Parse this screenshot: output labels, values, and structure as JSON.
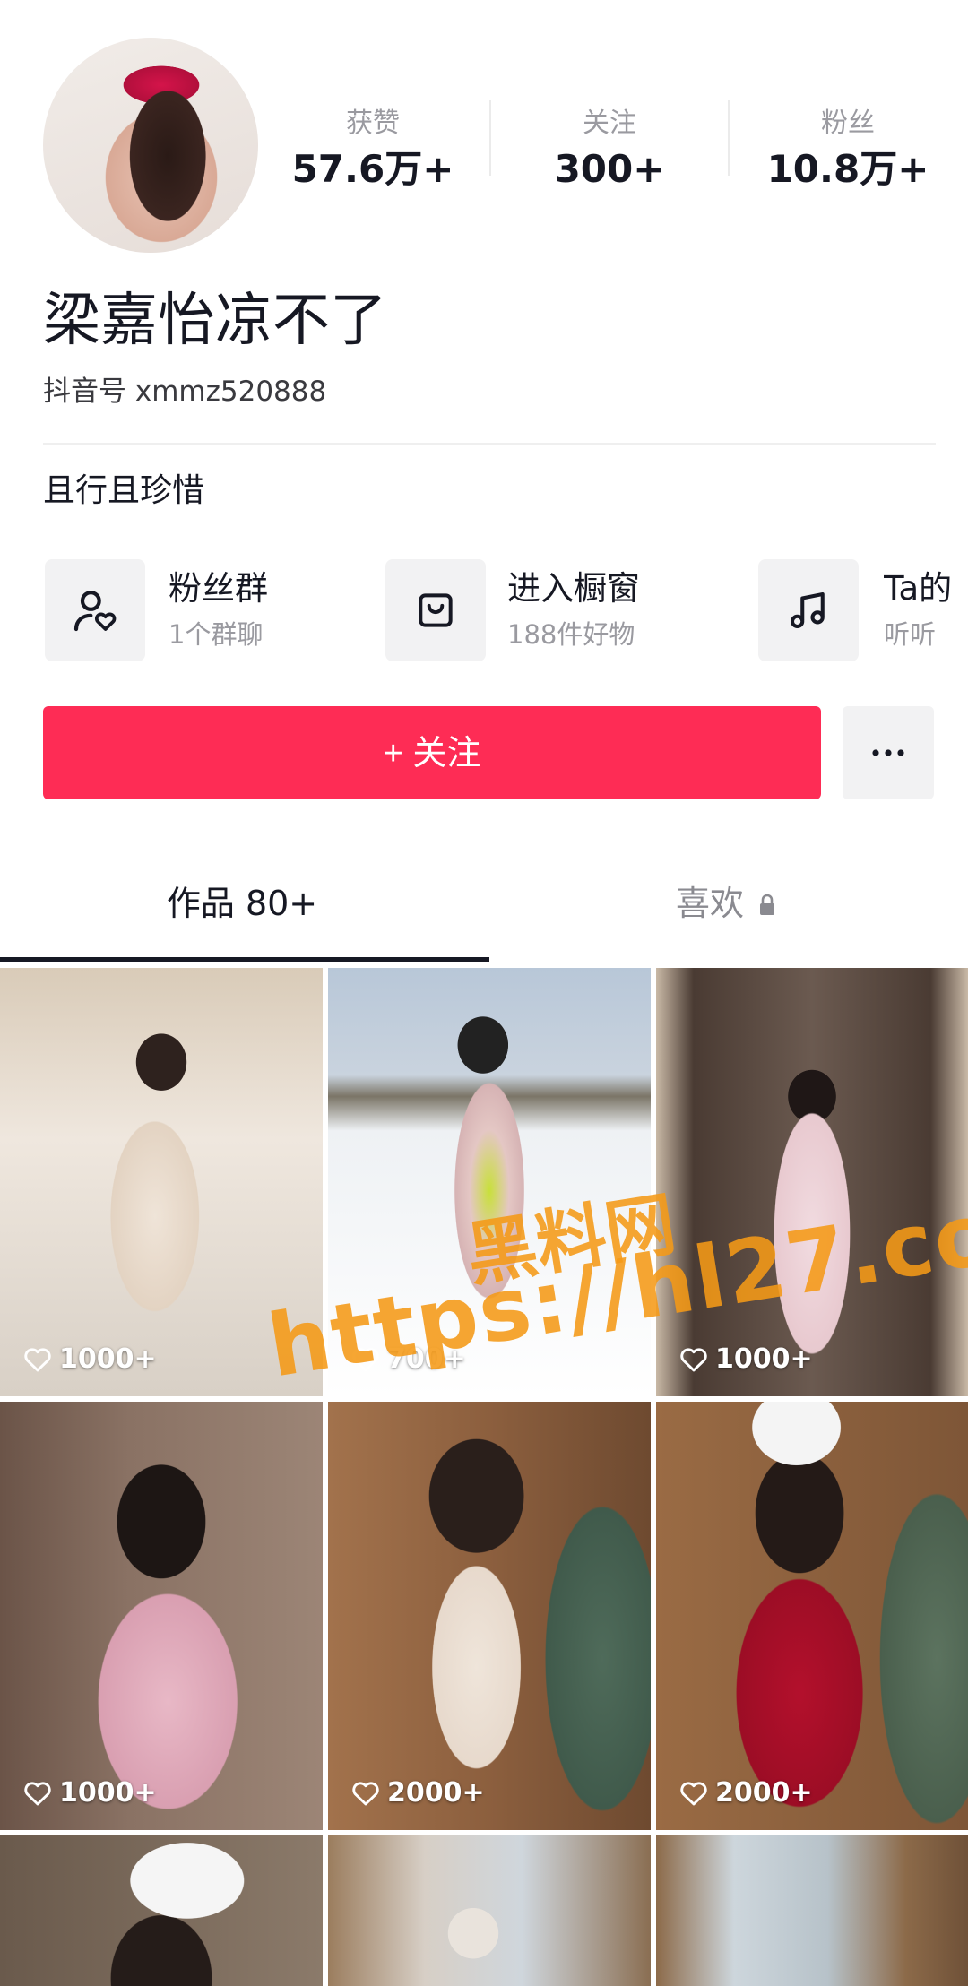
{
  "profile": {
    "name": "梁嘉怡凉不了",
    "handle": "抖音号 xmmz520888",
    "bio": "且行且珍惜"
  },
  "stats": [
    {
      "label": "获赞",
      "value": "57.6万+"
    },
    {
      "label": "关注",
      "value": "300+"
    },
    {
      "label": "粉丝",
      "value": "10.8万+"
    }
  ],
  "shortcuts": [
    {
      "title": "粉丝群",
      "sub": "1个群聊",
      "icon": "fan-group-icon"
    },
    {
      "title": "进入橱窗",
      "sub": "188件好物",
      "icon": "shop-bag-icon"
    },
    {
      "title": "Ta的",
      "sub": "听听",
      "icon": "music-note-icon"
    }
  ],
  "actions": {
    "follow_label": "+ 关注"
  },
  "tabs": {
    "works": "作品 80+",
    "likes": "喜欢"
  },
  "videos": [
    {
      "likes": "1000+"
    },
    {
      "likes": "700+"
    },
    {
      "likes": "1000+"
    },
    {
      "likes": "1000+"
    },
    {
      "likes": "2000+"
    },
    {
      "likes": "2000+"
    }
  ],
  "watermark": {
    "line1": "黑料网",
    "line2": "https://hl27.co"
  },
  "colors": {
    "accent": "#fe2c55",
    "watermark": "#f59a17"
  }
}
